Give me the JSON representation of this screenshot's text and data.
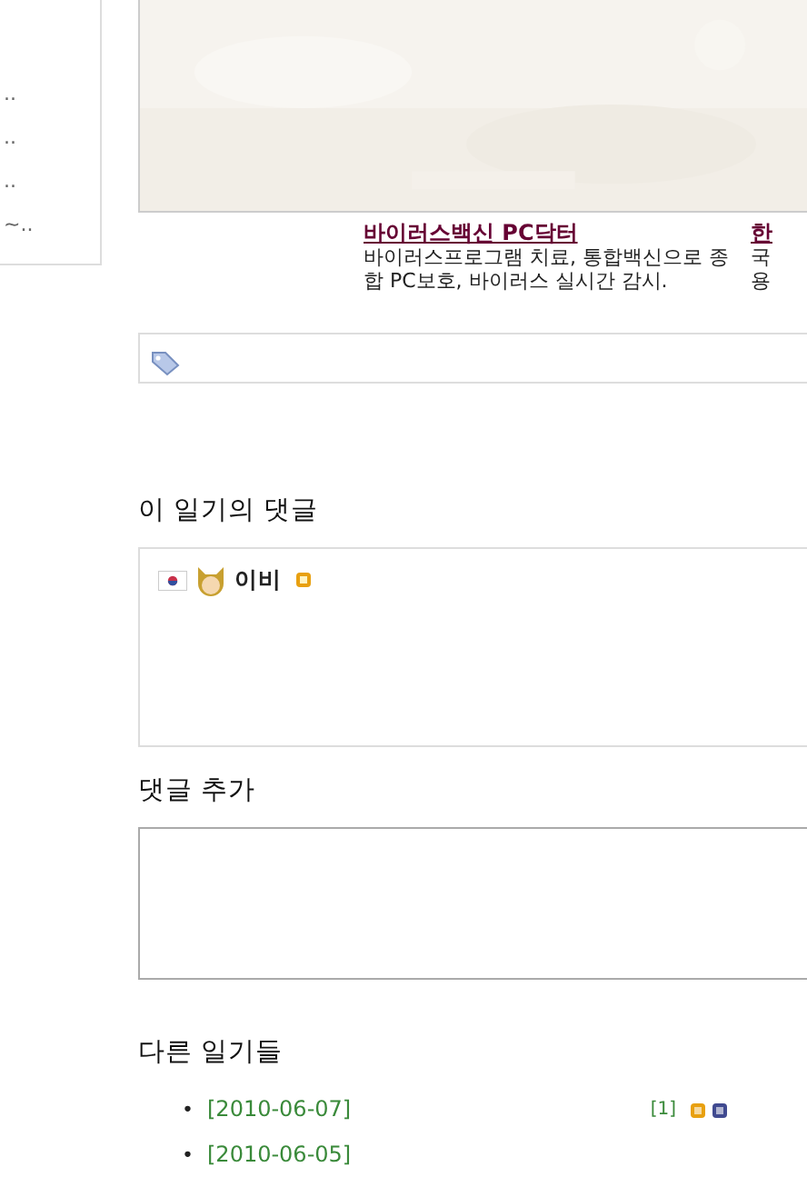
{
  "sidebar": {
    "items": [
      {
        "text": ".."
      },
      {
        "text": ".."
      },
      {
        "text": ".."
      },
      {
        "text": "~.."
      }
    ]
  },
  "ads": [
    {
      "title": "바이러스백신 PC닥터",
      "lines": [
        "바이러스프로그램 치료, 통합백신으로 종",
        "합 PC보호, 바이러스 실시간 감시."
      ]
    },
    {
      "title": "한",
      "lines": [
        "국",
        "용"
      ]
    }
  ],
  "comments_section": {
    "heading": "이 일기의 댓글",
    "comments": [
      {
        "name": "이비",
        "new": true
      }
    ]
  },
  "add_comment": {
    "heading": "댓글 추가"
  },
  "other_diaries": {
    "heading": "다른 일기들",
    "entries": [
      {
        "marker": "•",
        "date": "[2010-06-07]",
        "count": "[1]",
        "badges": [
          {
            "color": "#e8a010"
          },
          {
            "color": "#404a90"
          }
        ]
      },
      {
        "marker": "•",
        "date": "[2010-06-05]"
      }
    ]
  }
}
